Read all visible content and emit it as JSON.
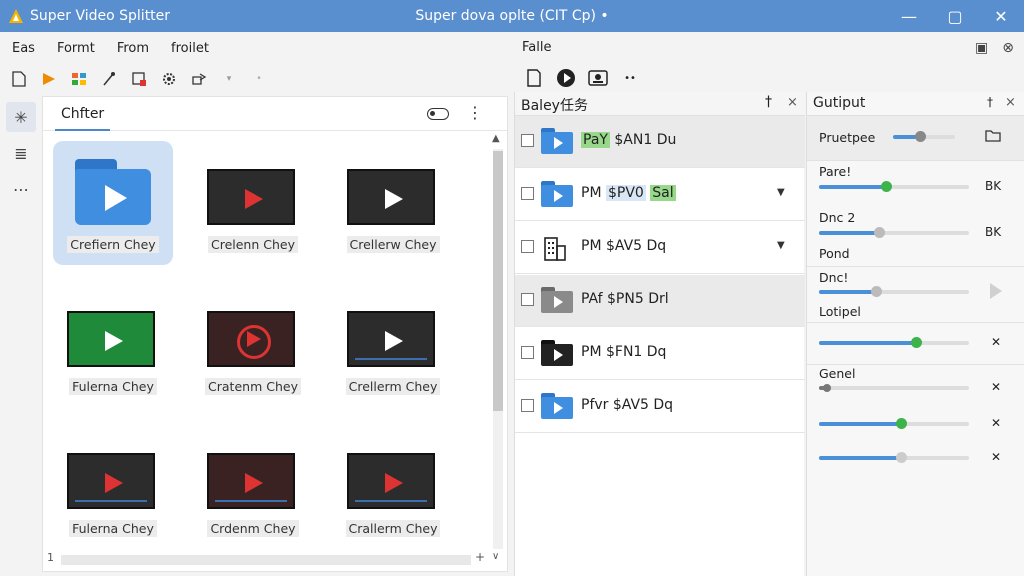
{
  "window": {
    "app_title": "Super Video Splitter",
    "center_title": "Super dova oplte (CIT Cp) •",
    "minimize": "—",
    "maximize": "▢",
    "close": "✕"
  },
  "menu": {
    "items": [
      "Eas",
      "Formt",
      "From",
      "froilet"
    ]
  },
  "toolbar": {
    "icons": [
      "new-file-icon",
      "play-flag-icon",
      "grid-icon",
      "wand-icon",
      "export-icon",
      "settings-gear-icon",
      "share-icon",
      "dropdown-icon",
      "more-dot-icon"
    ]
  },
  "left_strip": {
    "items": [
      "asterisk-icon",
      "filter-lines-icon",
      "ellipsis-icon"
    ],
    "glyphs": [
      "✳",
      "≣",
      "⋯"
    ]
  },
  "gallery": {
    "tab_label": "Chfter",
    "more": "⋮",
    "tiles": [
      {
        "label": "Crefiern Chey",
        "kind": "folder"
      },
      {
        "label": "Crelenn Chey",
        "kind": "red"
      },
      {
        "label": "Crellerw Chey",
        "kind": "white"
      },
      {
        "label": "Fulerna Chey",
        "kind": "green"
      },
      {
        "label": "Cratenm Chey",
        "kind": "reel"
      },
      {
        "label": "Crellerm Chey",
        "kind": "white"
      },
      {
        "label": "Fulerna Chey",
        "kind": "red"
      },
      {
        "label": "Crdenm Chey",
        "kind": "red"
      },
      {
        "label": "Crallerm Chey",
        "kind": "red"
      }
    ],
    "scroll_left": "1",
    "scroll_right": "+",
    "scroll_up": "▲",
    "scroll_down": "∨"
  },
  "right_menu": {
    "label": "Falle",
    "icons": [
      "panel-icon",
      "close-panel-icon"
    ]
  },
  "right_toolbar": {
    "icons": [
      "document-icon",
      "play-circle-icon",
      "camera-icon",
      "more-dots-icon"
    ],
    "more": "••"
  },
  "queue": {
    "title": "Baley任务",
    "pin": "†",
    "close": "×",
    "rows": [
      {
        "pre": "",
        "hl": "PaY",
        "text": " $AN1 Du",
        "hl_style": "green",
        "icon": "folder-blue",
        "dropdown": false,
        "highlight": true
      },
      {
        "pre": "PM ",
        "hl": "$PV0",
        "hl2": "Sal",
        "text": "",
        "hl_style": "blue",
        "icon": "folder-blue",
        "dropdown": true,
        "highlight": false
      },
      {
        "pre": "PM ",
        "hl": "",
        "text": "$AV5 Dq",
        "hl_style": "",
        "icon": "building",
        "dropdown": true,
        "highlight": false
      },
      {
        "pre": "PAf ",
        "hl": "",
        "text": "$PN5 Drl",
        "hl_style": "",
        "icon": "folder-gray",
        "dropdown": false,
        "highlight": true
      },
      {
        "pre": "PM ",
        "hl": "",
        "text": "$FN1 Dq",
        "hl_style": "",
        "icon": "folder-black",
        "dropdown": false,
        "highlight": false
      },
      {
        "pre": "Pfvr ",
        "hl": "",
        "text": "$AV5 Dq",
        "hl_style": "",
        "icon": "folder-blue",
        "dropdown": false,
        "highlight": false
      }
    ],
    "dropdown_glyph": "▼"
  },
  "output": {
    "title": "Gutiput",
    "pin": "†",
    "close": "×",
    "rows": [
      {
        "label": "Pruetpee",
        "value": 0.45,
        "right": "folder-icon",
        "knob": "gray"
      },
      {
        "label": "Pare!",
        "value": 0.45,
        "right_text": "BK",
        "knob": "green"
      },
      {
        "label": "Dnc 2",
        "value": 0.4,
        "right_text": "BK",
        "knob": "gray",
        "sub": "Pond"
      },
      {
        "label": "Dnc!",
        "value": 0.38,
        "right": "play-icon",
        "knob": "gray",
        "sub": "Lotipel"
      },
      {
        "label": "",
        "value": 0.65,
        "right_text": "✕",
        "knob": "green"
      },
      {
        "label": "Genel",
        "value": 0.05,
        "right_text": "✕",
        "knob": "gray"
      },
      {
        "label": "",
        "value": 0.55,
        "right_text": "✕",
        "knob": "green"
      },
      {
        "label": "",
        "value": 0.55,
        "right_text": "✕",
        "knob": "gray"
      }
    ]
  },
  "colors": {
    "titlebar": "#5a8fcf",
    "accent": "#4a90d9",
    "green": "#3cb44b"
  }
}
